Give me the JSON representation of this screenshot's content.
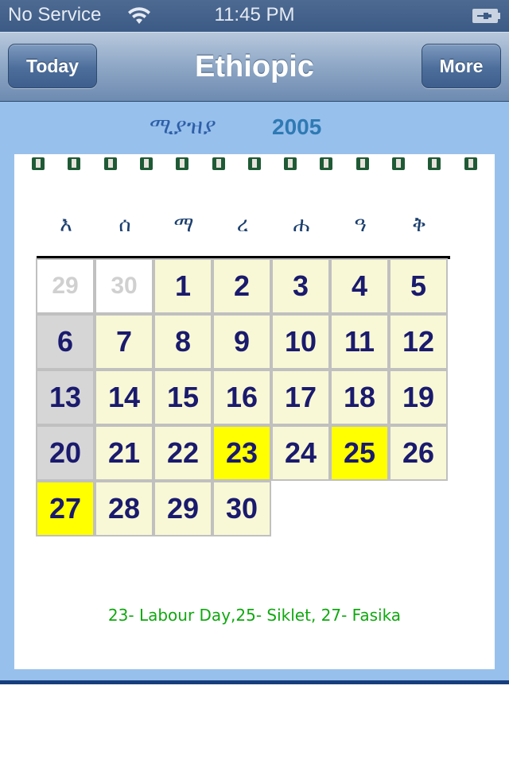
{
  "status_bar": {
    "carrier": "No Service",
    "time": "11:45 PM",
    "wifi_icon": "wifi-icon",
    "battery_icon": "battery-charging-icon"
  },
  "nav_bar": {
    "title": "Ethiopic",
    "left_button": "Today",
    "right_button": "More"
  },
  "month_header": {
    "month": "ሚያዝያ",
    "year": "2005"
  },
  "weekdays": [
    "እ",
    "ሰ",
    "ማ",
    "ረ",
    "ሐ",
    "ዓ",
    "ቅ"
  ],
  "calendar": {
    "weeks": [
      [
        {
          "day": "29",
          "type": "other"
        },
        {
          "day": "30",
          "type": "other"
        },
        {
          "day": "1",
          "type": "normal"
        },
        {
          "day": "2",
          "type": "normal"
        },
        {
          "day": "3",
          "type": "normal"
        },
        {
          "day": "4",
          "type": "normal"
        },
        {
          "day": "5",
          "type": "normal"
        }
      ],
      [
        {
          "day": "6",
          "type": "sunday"
        },
        {
          "day": "7",
          "type": "normal"
        },
        {
          "day": "8",
          "type": "normal"
        },
        {
          "day": "9",
          "type": "normal"
        },
        {
          "day": "10",
          "type": "normal"
        },
        {
          "day": "11",
          "type": "normal"
        },
        {
          "day": "12",
          "type": "normal"
        }
      ],
      [
        {
          "day": "13",
          "type": "sunday"
        },
        {
          "day": "14",
          "type": "normal"
        },
        {
          "day": "15",
          "type": "normal"
        },
        {
          "day": "16",
          "type": "normal"
        },
        {
          "day": "17",
          "type": "normal"
        },
        {
          "day": "18",
          "type": "normal"
        },
        {
          "day": "19",
          "type": "normal"
        }
      ],
      [
        {
          "day": "20",
          "type": "sunday"
        },
        {
          "day": "21",
          "type": "normal"
        },
        {
          "day": "22",
          "type": "normal"
        },
        {
          "day": "23",
          "type": "holiday"
        },
        {
          "day": "24",
          "type": "normal"
        },
        {
          "day": "25",
          "type": "holiday"
        },
        {
          "day": "26",
          "type": "normal"
        }
      ],
      [
        {
          "day": "27",
          "type": "holiday"
        },
        {
          "day": "28",
          "type": "normal"
        },
        {
          "day": "29",
          "type": "normal"
        },
        {
          "day": "30",
          "type": "normal"
        }
      ]
    ],
    "colors": {
      "normal": "#f8f8d6",
      "sunday": "#d6d6d6",
      "holiday": "#ffff00",
      "day_text": "#1a1a6e"
    }
  },
  "holiday_note": "23- Labour Day,25- Siklet, 27- Fasika"
}
